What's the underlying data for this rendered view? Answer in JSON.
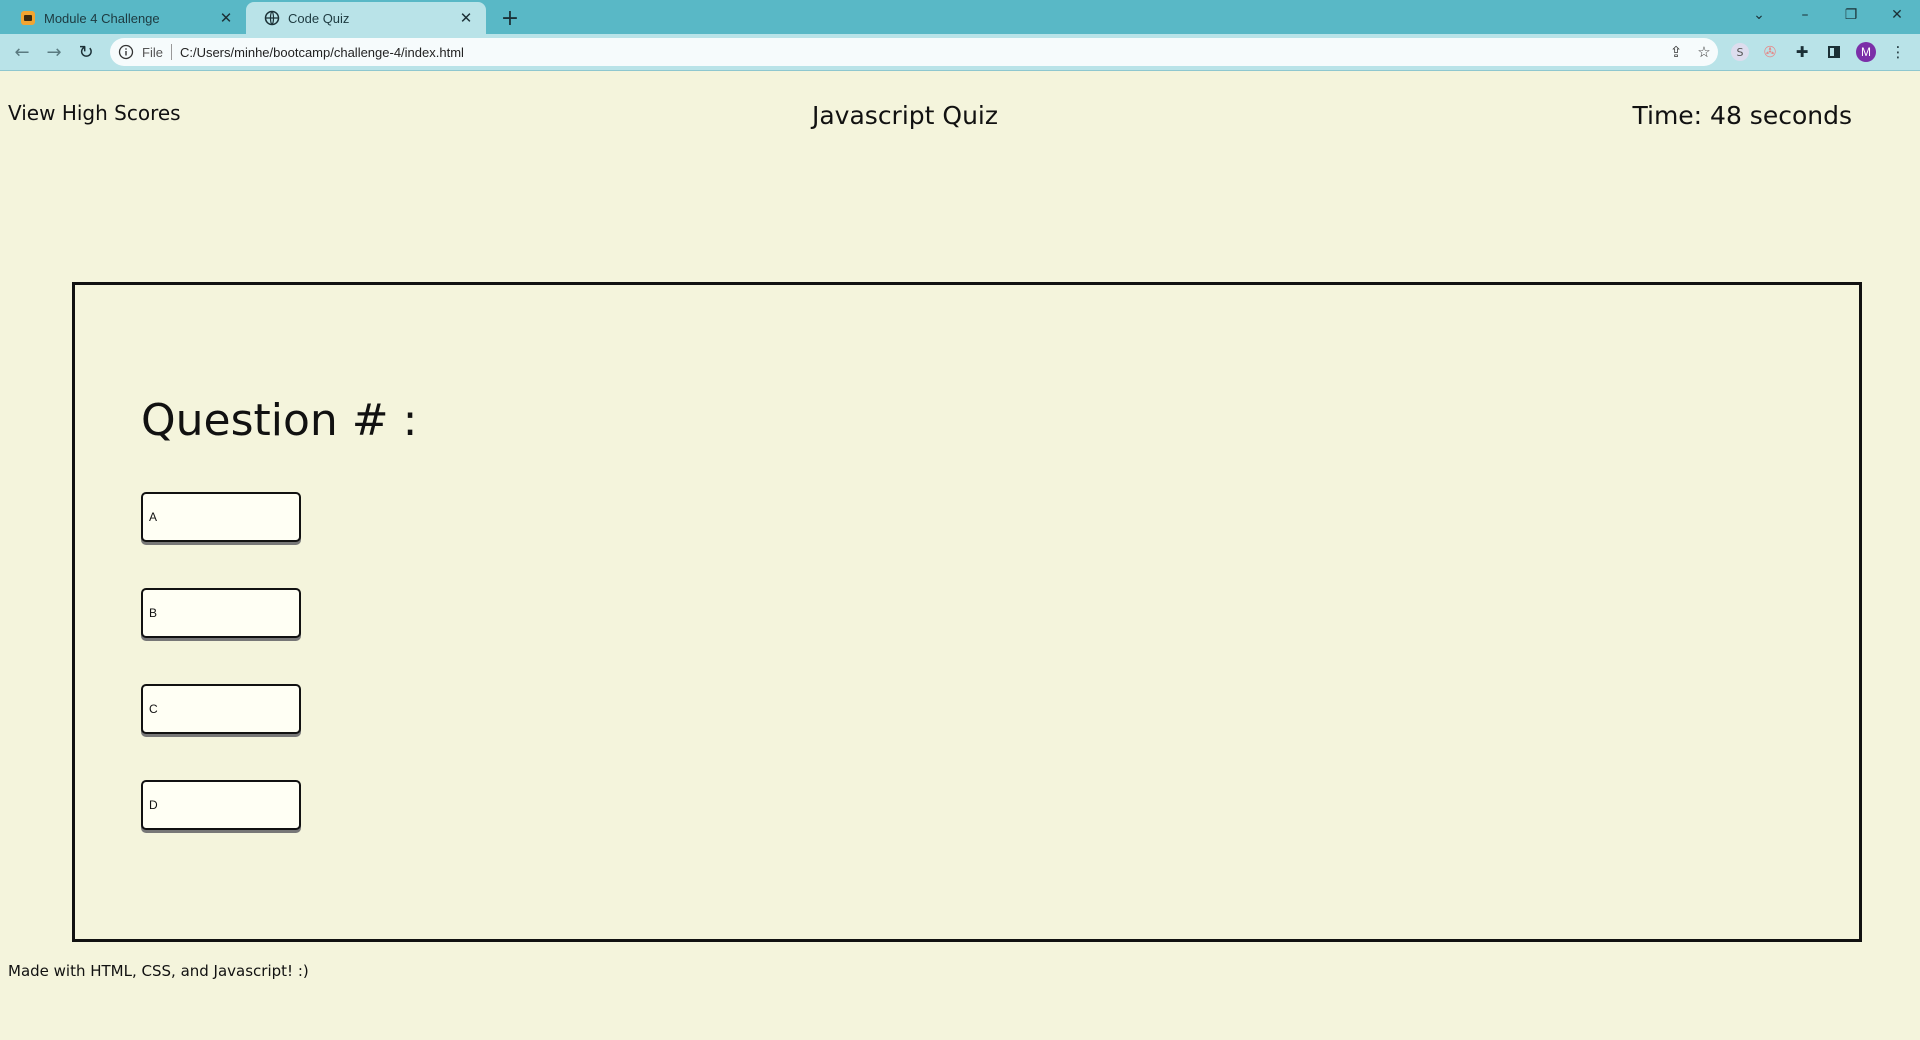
{
  "browser": {
    "tabs": [
      {
        "title": "Module 4 Challenge",
        "active": false
      },
      {
        "title": "Code Quiz",
        "active": true
      }
    ],
    "file_label": "File",
    "url": "C:/Users/minhe/bootcamp/challenge-4/index.html",
    "profile_initial": "M",
    "accent_color": "#59b8c6",
    "toolbar_color": "#b9e3e8"
  },
  "page": {
    "high_scores_link": "View High Scores",
    "title": "Javascript Quiz",
    "timer": "Time: 48 seconds",
    "question": "Question # :",
    "answers": [
      "A",
      "B",
      "C",
      "D"
    ],
    "footer": "Made with HTML, CSS, and Javascript! :)",
    "background_color": "#f4f4dc"
  }
}
